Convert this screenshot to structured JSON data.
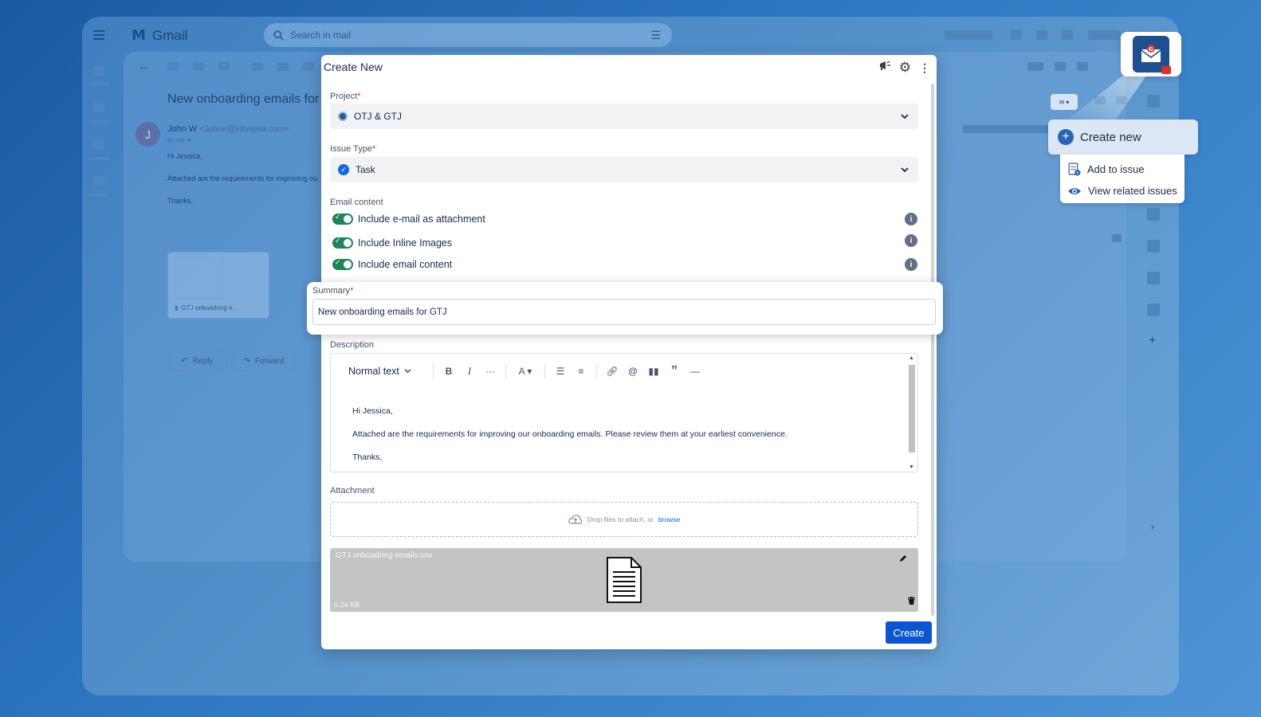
{
  "gmail": {
    "logo_text": "Gmail",
    "search_placeholder": "Search in mail",
    "subject": "New onboarding emails for",
    "avatar_initial": "J",
    "sender_name": "John W",
    "sender_email": "<Johnw@infosysta.com>",
    "to_me": "to me",
    "body_lines": [
      "Hi Jessica,",
      "Attached are the requirements for improving ou",
      "Thanks,"
    ],
    "attachment_name": "GTJ onboadring e...",
    "reply_label": "Reply",
    "forward_label": "Forward"
  },
  "addon_menu": {
    "create_new": "Create new",
    "items": [
      "Add to issue",
      "View related issues"
    ]
  },
  "dialog": {
    "title": "Create New",
    "project_label": "Project",
    "project_value": "OTJ & GTJ",
    "issue_type_label": "Issue Type",
    "issue_type_value": "Task",
    "email_content_label": "Email content",
    "toggles": [
      "Include e-mail as attachment",
      "Include Inline Images",
      "Include email content"
    ],
    "summary_label": "Summary",
    "summary_value": "New onboarding emails for GTJ",
    "description_label": "Description",
    "text_style": "Normal text",
    "description_lines": [
      "Hi Jessica,",
      "Attached are the requirements for improving our onboarding emails. Please review them at your earliest convenience.",
      "Thanks,"
    ],
    "attachment_label": "Attachment",
    "drop_text": "Drop files to attach, or",
    "browse_text": "browse",
    "file_name": "GTJ onboadring emails.csv",
    "file_size": "9.24 KB",
    "create_button": "Create"
  },
  "colors": {
    "accent": "#0c55cf",
    "toggle_on": "#1f845a",
    "required": "#c9372c",
    "addon_brand": "#1e4f8f"
  }
}
